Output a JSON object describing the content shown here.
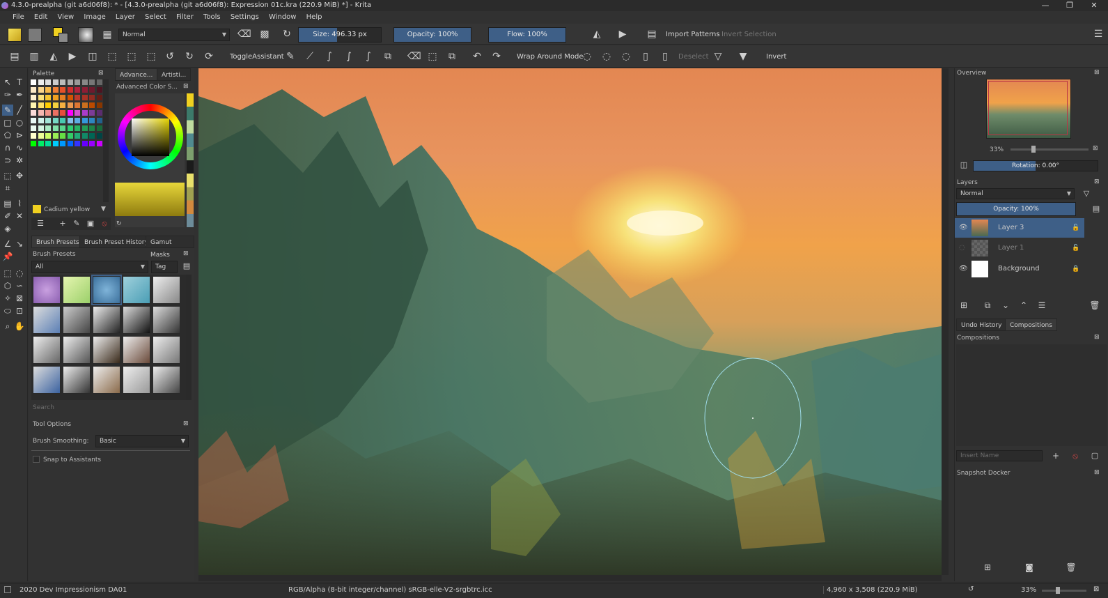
{
  "titlebar": {
    "title": "4.3.0-prealpha (git a6d06f8): * - [4.3.0-prealpha (git a6d06f8): Expression 01c.kra (220.9 MiB) *] - Krita"
  },
  "menu": [
    "File",
    "Edit",
    "View",
    "Image",
    "Layer",
    "Select",
    "Filter",
    "Tools",
    "Settings",
    "Window",
    "Help"
  ],
  "toolbar1": {
    "blend_mode": "Normal",
    "size": "Size: 496.33 px",
    "opacity": "Opacity: 100%",
    "flow": "Flow: 100%",
    "import_patterns": "Import Patterns",
    "invert_selection": "Invert Selection",
    "size_fraction": 0.47,
    "opacity_fraction": 1.0,
    "flow_fraction": 1.0
  },
  "toolbar2": {
    "toggle_assistant": "ToggleAssistant",
    "wrap_around": "Wrap Around Mode",
    "deselect": "Deselect",
    "invert": "Invert"
  },
  "left": {
    "palette_title": "Palette",
    "tab_advanced": "Advance...",
    "tab_artistic": "Artisti...",
    "advanced_color_title": "Advanced Color S...",
    "current_color_name": "Cadium yellow",
    "brush_tabs": [
      "Brush Presets",
      "Brush Preset History",
      "Gamut Masks"
    ],
    "brush_presets_title": "Brush Presets",
    "brush_filter": "All",
    "tag_label": "Tag",
    "search_placeholder": "Search",
    "tool_options_title": "Tool Options",
    "brush_smoothing_label": "Brush Smoothing:",
    "brush_smoothing_value": "Basic",
    "snap_label": "Snap to Assistants"
  },
  "right": {
    "overview_title": "Overview",
    "zoom": "33%",
    "rotation": "Rotation: 0.00°",
    "layers_title": "Layers",
    "layer_mode": "Normal",
    "layer_opacity": "Opacity: 100%",
    "layers": [
      {
        "name": "Layer 3",
        "visible": true,
        "selected": true
      },
      {
        "name": "Layer 1",
        "visible": false,
        "selected": false
      },
      {
        "name": "Background",
        "visible": true,
        "selected": false
      }
    ],
    "tabs": [
      "Undo History",
      "Compositions"
    ],
    "compositions_title": "Compositions",
    "insert_name_placeholder": "Insert Name",
    "snapshot_title": "Snapshot Docker"
  },
  "status": {
    "brush_name": "2020 Dev Impressionism DA01",
    "color_space": "RGB/Alpha (8-bit integer/channel)  sRGB-elle-V2-srgbtrc.icc",
    "dimensions": "4,960 x 3,508 (220.9 MiB)",
    "zoom": "33%"
  },
  "colors": {
    "accent": "#3e5f87",
    "fg_color": "#f0d020",
    "bg_color": "#8a8a8a"
  }
}
